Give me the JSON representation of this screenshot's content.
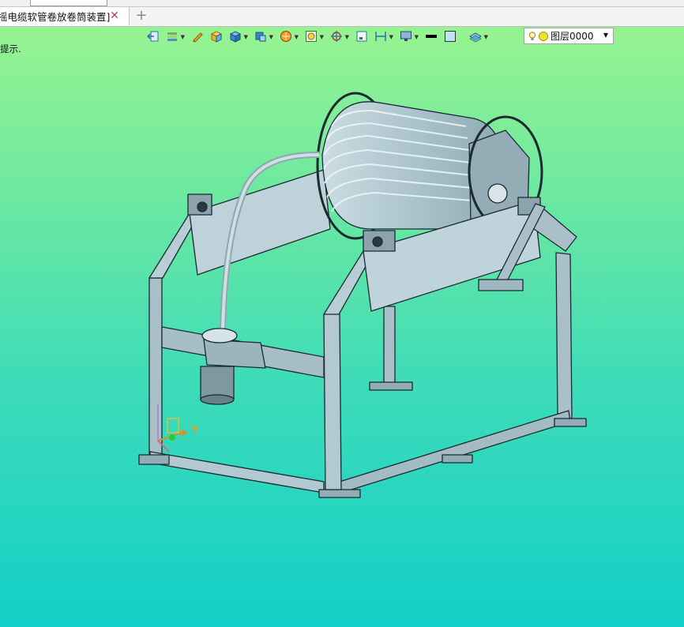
{
  "document": {
    "tab_title": "摇电缆软管卷放卷筒装置]",
    "close_glyph": "✕",
    "add_glyph": "+"
  },
  "toolbar": {
    "buttons": [
      {
        "icon": "exit-sketch-icon",
        "dropdown": false
      },
      {
        "icon": "layer-stack-icon",
        "dropdown": true
      },
      {
        "icon": "pencil-icon",
        "dropdown": false
      },
      {
        "icon": "box-yellow-icon",
        "dropdown": false
      },
      {
        "icon": "cube-blue-icon",
        "dropdown": true
      },
      {
        "icon": "view-cube-icon",
        "dropdown": true
      },
      {
        "icon": "render-orange-icon",
        "dropdown": true
      },
      {
        "icon": "zoom-fit-icon",
        "dropdown": true
      },
      {
        "icon": "target-icon",
        "dropdown": true
      },
      {
        "icon": "frame-icon",
        "dropdown": false
      },
      {
        "icon": "dimension-icon",
        "dropdown": true
      },
      {
        "icon": "monitor-icon",
        "dropdown": true
      },
      {
        "icon": "line-black-icon",
        "dropdown": false
      },
      {
        "icon": "color-swatch-icon",
        "dropdown": false
      },
      {
        "icon": "layers-icon",
        "dropdown": true
      }
    ],
    "layer_combo": {
      "value": "图层0000",
      "dropdown_glyph": "▼"
    }
  },
  "status": {
    "hint_text": "提示."
  },
  "triad": {
    "y_label": "Y"
  },
  "colors": {
    "bg_top": "#9ef58e",
    "bg_bottom": "#12cfc8",
    "metal": "#b4cbd4",
    "metal_dark": "#7e959d",
    "edge": "#1a2a30"
  }
}
